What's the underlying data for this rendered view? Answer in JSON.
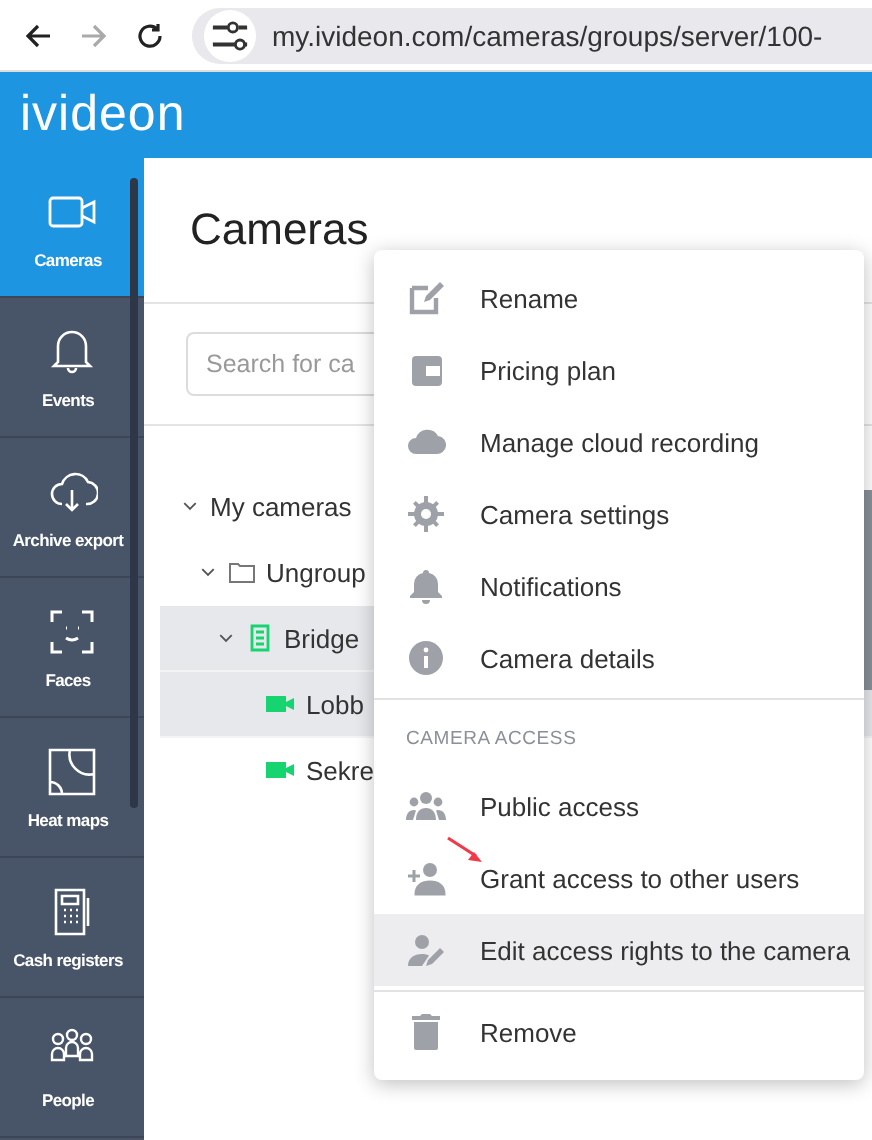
{
  "browser": {
    "url": "my.ivideon.com/cameras/groups/server/100-",
    "forward_disabled": true
  },
  "header": {
    "logo": "ivideon"
  },
  "sidebar": {
    "items": [
      {
        "label": "Cameras",
        "selected": true
      },
      {
        "label": "Events",
        "selected": false
      },
      {
        "label": "Archive export",
        "selected": false
      },
      {
        "label": "Faces",
        "selected": false
      },
      {
        "label": "Heat maps",
        "selected": false
      },
      {
        "label": "Cash registers",
        "selected": false
      },
      {
        "label": "People",
        "selected": false
      }
    ]
  },
  "page": {
    "title": "Cameras",
    "search": {
      "placeholder": "Search for ca"
    }
  },
  "tree": [
    {
      "label": "My cameras",
      "expanded": true,
      "highlighted": false,
      "children": [
        {
          "label": "Ungroup",
          "kind": "folder",
          "expanded": true,
          "highlighted": false,
          "children": [
            {
              "label": "Bridge",
              "kind": "server",
              "expanded": true,
              "highlighted": true,
              "children": [
                {
                  "label": "Lobb",
                  "kind": "camera",
                  "highlighted": true
                },
                {
                  "label": "Sekre",
                  "kind": "camera",
                  "highlighted": false
                }
              ]
            }
          ]
        }
      ]
    }
  ],
  "menu": {
    "groups": [
      {
        "items": [
          {
            "label": "Rename",
            "hovered": false
          },
          {
            "label": "Pricing plan",
            "hovered": false
          },
          {
            "label": "Manage cloud recording",
            "hovered": false
          },
          {
            "label": "Camera settings",
            "hovered": false
          },
          {
            "label": "Notifications",
            "hovered": false
          },
          {
            "label": "Camera details",
            "hovered": false
          }
        ]
      },
      {
        "title": "CAMERA ACCESS",
        "items": [
          {
            "label": "Public access",
            "hovered": false
          },
          {
            "label": "Grant access to other users",
            "hovered": false,
            "annotated": true
          },
          {
            "label": "Edit access rights to the camera",
            "hovered": true
          }
        ]
      },
      {
        "items": [
          {
            "label": "Remove",
            "hovered": false
          }
        ]
      }
    ]
  }
}
